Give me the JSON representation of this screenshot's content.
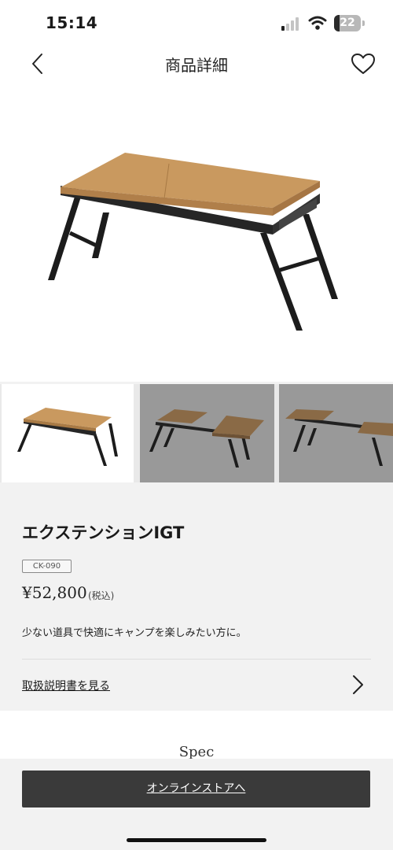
{
  "status": {
    "time": "15:14",
    "battery": 22
  },
  "nav": {
    "title": "商品詳細"
  },
  "product": {
    "name": "エクステンションIGT",
    "model": "CK-090",
    "price": "¥52,800",
    "tax_note": "(税込)",
    "description": "少ない道具で快適にキャンプを楽しみたい方に。",
    "manual_link": "取扱説明書を見る"
  },
  "spec": {
    "heading": "Spec"
  },
  "cta": {
    "label": "オンラインストアへ"
  },
  "thumbnails": [
    {
      "state": "selected",
      "variant": "folded-table"
    },
    {
      "state": "unselected",
      "variant": "extended-table"
    },
    {
      "state": "unselected",
      "variant": "extended-table"
    }
  ],
  "colors": {
    "accent_dark": "#3a3a3a",
    "wood": "#c9995f",
    "thumb_background": "#999999"
  },
  "icons": {
    "back": "chevron-left-icon",
    "favorite": "heart-outline-icon",
    "manual": "chevron-right-icon"
  }
}
